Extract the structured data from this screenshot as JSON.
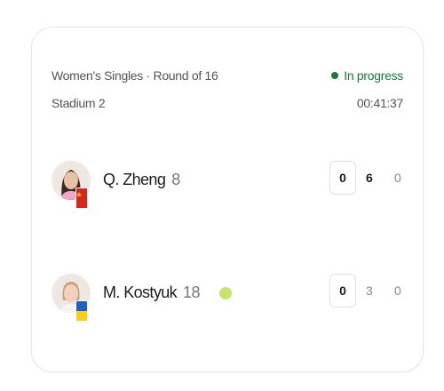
{
  "match": {
    "event": "Women's Singles · Round of 16",
    "court": "Stadium 2",
    "status": "In progress",
    "elapsed": "00:41:37",
    "status_color": "#177a3e"
  },
  "players": [
    {
      "name": "Q. Zheng",
      "seed": "8",
      "flag": "china-flag",
      "serving": false,
      "game_score": "0",
      "sets": [
        "6",
        "0"
      ]
    },
    {
      "name": "M. Kostyuk",
      "seed": "18",
      "flag": "ukraine-flag",
      "serving": true,
      "game_score": "0",
      "sets": [
        "3",
        "0"
      ]
    }
  ],
  "colors": {
    "serve_ball": "#c6e66a",
    "china_flag": "#d7261b",
    "ukraine_blue": "#1f5fc4",
    "ukraine_yellow": "#f7d117"
  }
}
